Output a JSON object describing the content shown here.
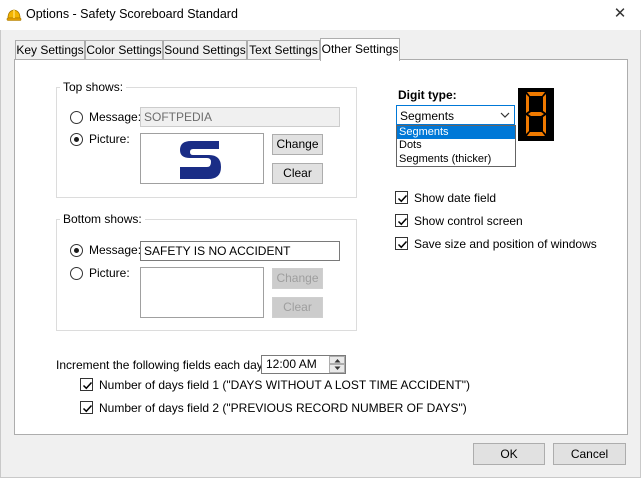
{
  "window": {
    "title": "Options - Safety Scoreboard Standard",
    "close_glyph": "✕",
    "icon": "hardhat-icon"
  },
  "tabs": [
    {
      "label": "Key Settings",
      "active": false
    },
    {
      "label": "Color Settings",
      "active": false
    },
    {
      "label": "Sound Settings",
      "active": false
    },
    {
      "label": "Text Settings",
      "active": false
    },
    {
      "label": "Other Settings",
      "active": true
    }
  ],
  "top_shows": {
    "label": "Top shows:",
    "message_label": "Message:",
    "message_value": "SOFTPEDIA",
    "message_selected": false,
    "picture_label": "Picture:",
    "picture_selected": true,
    "picture_logo_text": "S",
    "change_label": "Change",
    "clear_label": "Clear"
  },
  "bottom_shows": {
    "label": "Bottom shows:",
    "message_label": "Message:",
    "message_value": "SAFETY IS NO ACCIDENT",
    "message_selected": true,
    "picture_label": "Picture:",
    "picture_selected": false,
    "change_label": "Change",
    "clear_label": "Clear"
  },
  "digit_type": {
    "label": "Digit type:",
    "selected": "Segments",
    "options": [
      "Segments",
      "Dots",
      "Segments (thicker)"
    ],
    "preview_digit": "8",
    "preview_color": "#f07a00"
  },
  "options": [
    {
      "label": "Show date field",
      "checked": true
    },
    {
      "label": "Show control screen",
      "checked": true
    },
    {
      "label": "Save size and position of windows",
      "checked": true
    }
  ],
  "increment": {
    "label": "Increment the following fields each day at:",
    "time_value": "12:00 AM",
    "fields": [
      {
        "label": "Number of days field 1 (\"DAYS WITHOUT A LOST TIME ACCIDENT\")",
        "checked": true
      },
      {
        "label": "Number of days field 2 (\"PREVIOUS RECORD NUMBER OF DAYS\")",
        "checked": true
      }
    ]
  },
  "footer": {
    "ok_label": "OK",
    "cancel_label": "Cancel"
  },
  "colors": {
    "accent": "#0078d7",
    "logo_blue": "#1a2d86"
  }
}
